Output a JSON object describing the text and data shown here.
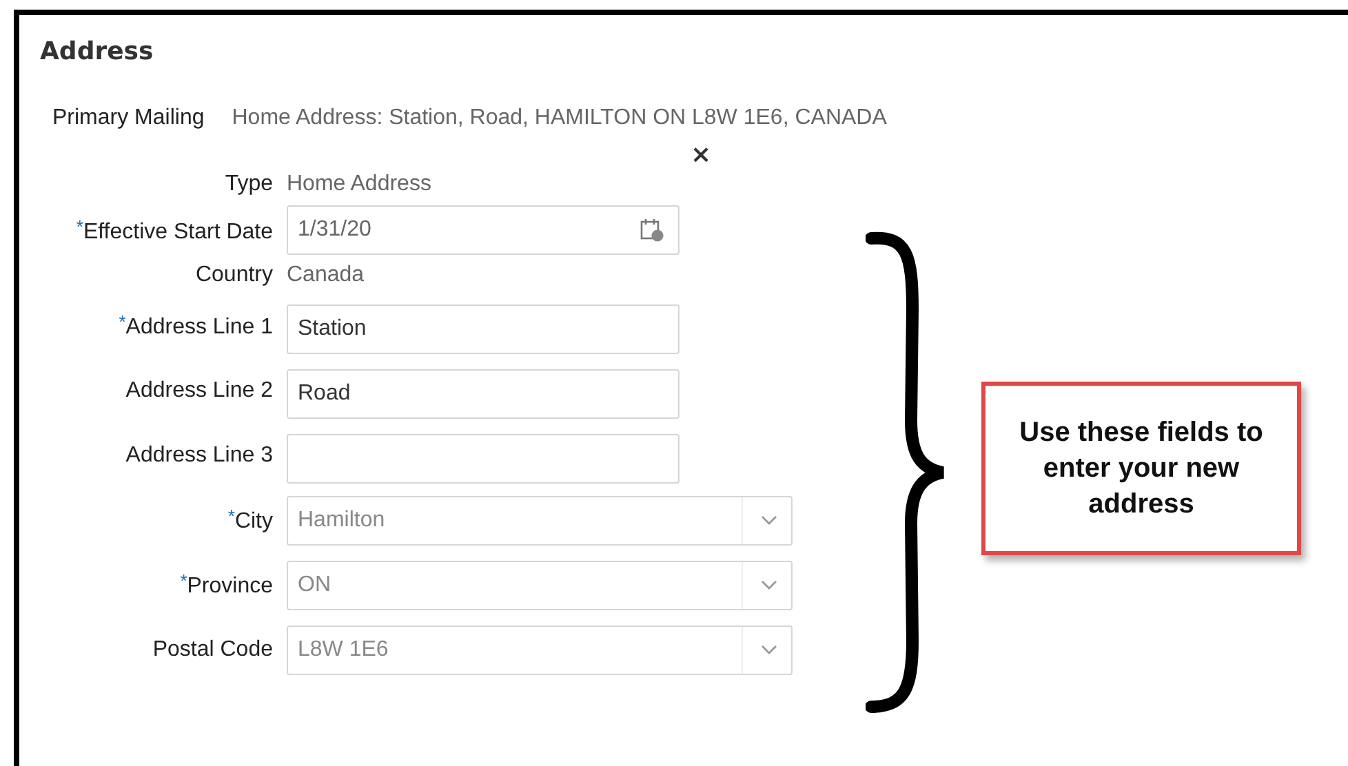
{
  "section": {
    "title": "Address"
  },
  "primary_mailing": {
    "label": "Primary Mailing",
    "value": "Home Address: Station, Road, HAMILTON ON L8W 1E6, CANADA"
  },
  "close": {
    "symbol": "×"
  },
  "fields": [
    {
      "kind": "text",
      "label": "Type",
      "value": "Home Address"
    },
    {
      "kind": "date",
      "label": "Effective Start Date",
      "required_mark": "*",
      "value": "1/31/20"
    },
    {
      "kind": "text",
      "label": "Country",
      "value": "Canada"
    },
    {
      "kind": "input",
      "label": "Address Line 1",
      "required_mark": "*",
      "value": "Station"
    },
    {
      "kind": "input",
      "label": "Address Line 2",
      "value": "Road"
    },
    {
      "kind": "input",
      "label": "Address Line 3"
    },
    {
      "kind": "select",
      "label": "City",
      "required_mark": "*",
      "value": "Hamilton"
    },
    {
      "kind": "select",
      "label": "Province",
      "required_mark": "*",
      "value": "ON"
    },
    {
      "kind": "select",
      "label": "Postal Code",
      "value": "L8W 1E6"
    }
  ],
  "callout": {
    "text": "Use these fields to enter your new address"
  }
}
